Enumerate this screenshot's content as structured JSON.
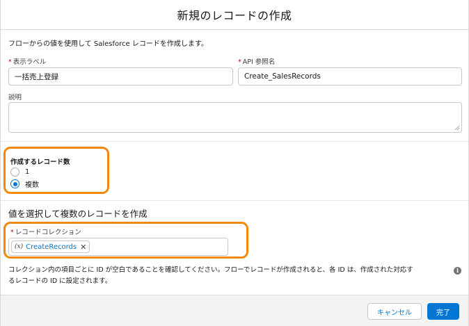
{
  "modal": {
    "title": "新規のレコードの作成",
    "description": "フローからの値を使用して Salesforce レコードを作成します。"
  },
  "fields": {
    "label": {
      "required": "*",
      "label": "表示ラベル",
      "value": "一括売上登録"
    },
    "api_name": {
      "required": "*",
      "label": "API 参照名",
      "value": "Create_SalesRecords"
    },
    "description": {
      "label": "説明",
      "value": ""
    }
  },
  "record_count": {
    "title": "作成するレコード数",
    "options": [
      {
        "label": "1",
        "checked": false
      },
      {
        "label": "複数",
        "checked": true
      }
    ]
  },
  "values_section": {
    "heading": "値を選択して複数のレコードを作成",
    "collection": {
      "required": "*",
      "label": "レコードコレクション",
      "pill_icon": "(x)",
      "pill_value": "CreateRecords",
      "pill_close": "✕"
    },
    "help_line1": "コレクション内の項目ごとに ID が空白であることを確認してください。フローでレコードが作成されると、各 ID は、作成された対応す",
    "help_line2": "るレコードの ID に設定されます。",
    "info_icon": "i"
  },
  "footer": {
    "cancel_label": "キャンセル",
    "done_label": "完了"
  },
  "colors": {
    "brand": "#0176d3",
    "highlight": "#f2890f",
    "required": "#ba0517"
  }
}
